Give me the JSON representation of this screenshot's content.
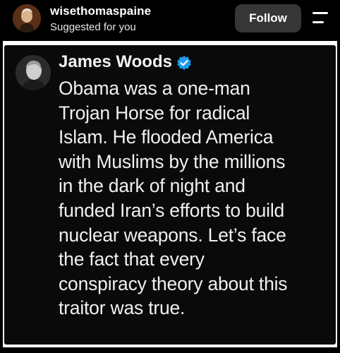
{
  "header": {
    "username": "wisethomaspaine",
    "subtitle": "Suggested for you",
    "follow_label": "Follow"
  },
  "post": {
    "author_name": "James Woods",
    "verified_icon": "verified-badge-icon",
    "text": "Obama was a one-man\nTrojan Horse for radical\nIslam. He flooded America\nwith Muslims by the millions\nin the dark of night and\nfunded Iran’s efforts to build\nnuclear weapons. Let’s face\nthe fact that every\nconspiracy theory about this\ntraitor was true."
  },
  "colors": {
    "background": "#000000",
    "follow_button": "#363636",
    "verified": "#1d9bf0"
  }
}
